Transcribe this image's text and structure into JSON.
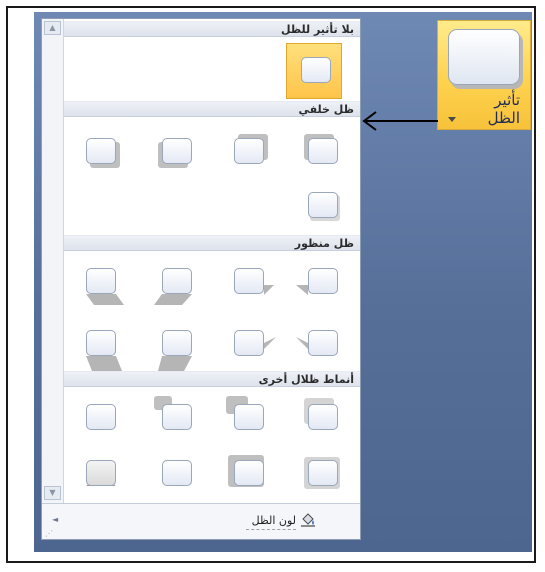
{
  "gallery": {
    "sections": [
      {
        "label": "بلا تأثير للظل"
      },
      {
        "label": "ظل خلفي"
      },
      {
        "label": "ظل منظور"
      },
      {
        "label": "أنماط ظلال أخرى"
      }
    ],
    "footer": {
      "label": "لون الظل"
    },
    "scroll": {
      "up": "▲",
      "down": "▼",
      "left": "◄"
    }
  },
  "ribbon_button": {
    "label_line1": "تأثير",
    "label_line2": "الظل",
    "icon": "shadow-effects-icon"
  },
  "colors": {
    "accent": "#ffd24f",
    "background": "#5d77a3"
  }
}
